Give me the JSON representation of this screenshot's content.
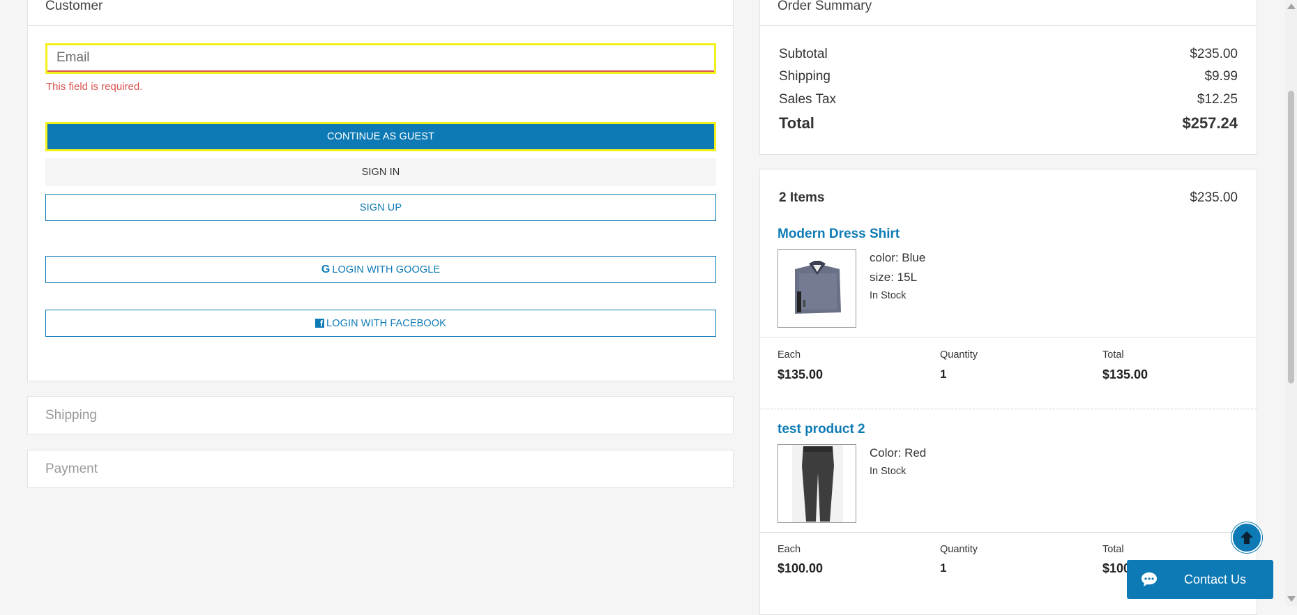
{
  "customer": {
    "title": "Customer",
    "email_placeholder": "Email",
    "email_value": "",
    "error": "This field is required.",
    "guest_label": "CONTINUE AS GUEST",
    "signin_label": "SIGN IN",
    "signup_label": "SIGN UP",
    "google_label": "LOGIN WITH GOOGLE",
    "facebook_label": "LOGIN WITH FACEBOOK"
  },
  "sections": {
    "shipping": "Shipping",
    "payment": "Payment"
  },
  "summary": {
    "title": "Order Summary",
    "subtotal_label": "Subtotal",
    "subtotal": "$235.00",
    "shipping_label": "Shipping",
    "shipping": "$9.99",
    "tax_label": "Sales Tax",
    "tax": "$12.25",
    "total_label": "Total",
    "total": "$257.24"
  },
  "cart": {
    "count_label": "2 Items",
    "amount": "$235.00",
    "col_each": "Each",
    "col_qty": "Quantity",
    "col_total": "Total",
    "items": [
      {
        "name": "Modern Dress Shirt",
        "opt1": "color: Blue",
        "opt2": "size: 15L",
        "stock": "In Stock",
        "each": "$135.00",
        "qty": "1",
        "total": "$135.00"
      },
      {
        "name": "test product 2",
        "opt1": "Color: Red",
        "stock": "In Stock",
        "each": "$100.00",
        "qty": "1",
        "total": "$100.00"
      }
    ]
  },
  "contact_label": "Contact Us",
  "colors": {
    "accent": "#0d7ab5",
    "error": "#d9534f",
    "focus": "#f4f01b"
  }
}
